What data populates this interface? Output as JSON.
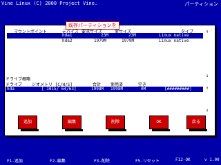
{
  "header": {
    "title": "Vine Linux (C) 2000 Project Vine.",
    "mode": "パーティション"
  },
  "dialog": {
    "title": "既存パーティションを"
  },
  "partitions": {
    "headers": {
      "mount": "マウントポイント",
      "device": "デバイス",
      "req": "要求サイズ",
      "actual": "実サイズ",
      "type": "タイプ"
    },
    "rows": [
      {
        "mount": "",
        "device": "hda1",
        "req": "23M",
        "actual": "23M",
        "type": "Linux native",
        "selected": true
      },
      {
        "mount": "",
        "device": "hda2",
        "req": "1979M",
        "actual": "1979M",
        "type": "Linux native",
        "selected": false
      }
    ]
  },
  "drives": {
    "section": "ドライブ概略",
    "headers": {
      "drive": "ドライブ",
      "geom": "ジオメトリ [C/H/S]",
      "total": "合計",
      "used": "使用済",
      "free": "空き"
    },
    "rows": [
      {
        "drive": "hda",
        "geom": "[ 1015/ 64/63]",
        "total": "1998M",
        "used": "1998M",
        "free": "0M",
        "bar": "[#########]"
      }
    ]
  },
  "buttons": [
    "追加",
    "編集",
    "削除",
    "OK",
    "戻る"
  ],
  "status": [
    "F1-追加",
    "F2-編集",
    "F3-削除",
    "F5-リセット",
    "F12-OK",
    "v 1.00"
  ]
}
